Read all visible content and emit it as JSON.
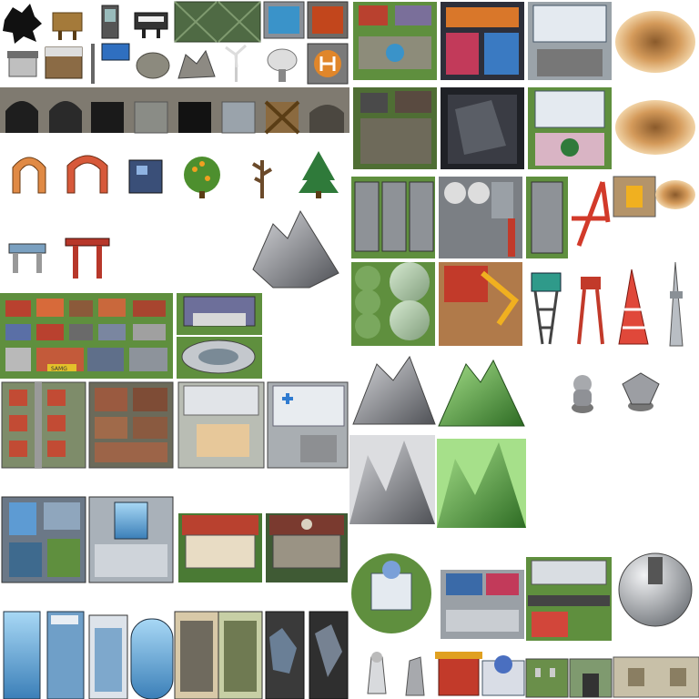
{
  "sheet": {
    "background": "#ffffff"
  },
  "signs": {
    "hotel_sign": "SAMG"
  },
  "palette": {
    "grass": "#5f8f3e",
    "grass_dark": "#3f6d2b",
    "roof_red": "#b9412f",
    "roof_blue": "#5a6fa6",
    "concrete": "#a7a9ad",
    "steel": "#6f7a86",
    "mountain_gray": "#7d7f84",
    "mountain_green": "#4b9a3a",
    "sand": "#c89355",
    "water": "#3a93c9",
    "tower_red": "#d23a2a",
    "glass": "#6fb3e3",
    "dark": "#2b2b2b"
  }
}
